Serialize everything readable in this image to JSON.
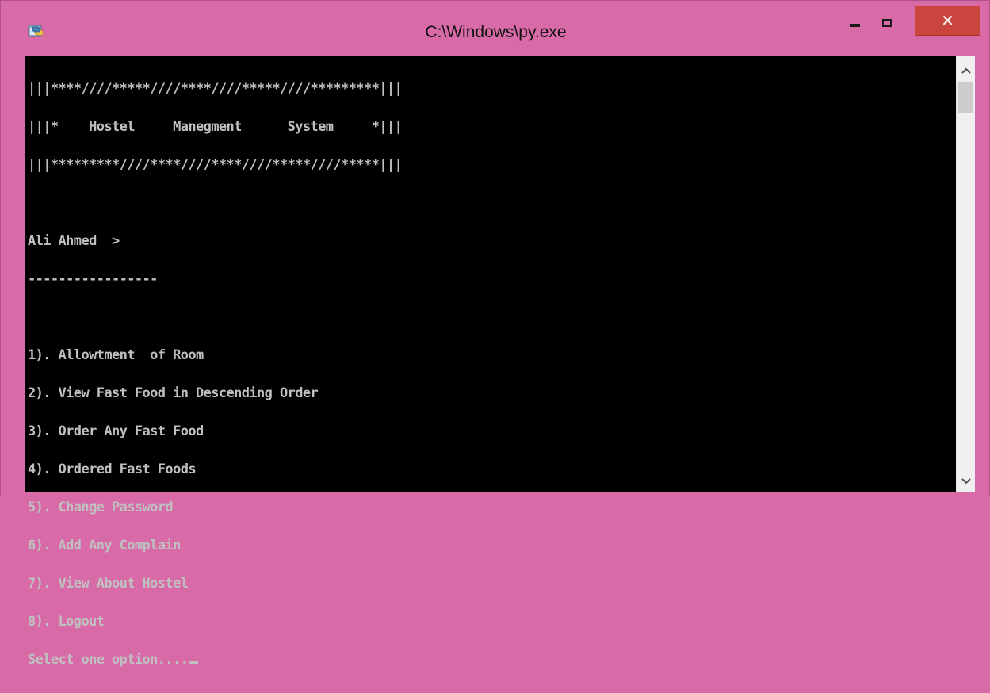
{
  "window": {
    "title": "C:\\Windows\\py.exe",
    "close_glyph": "✕"
  },
  "console": {
    "lines": [
      "|||****////*****////****////*****////*********|||",
      "|||*    Hostel     Manegment      System     *|||",
      "|||*********////****////****////*****////*****|||",
      "",
      "Ali Ahmed  >",
      "-----------------",
      "",
      "1). Allowtment  of Room",
      "2). View Fast Food in Descending Order",
      "3). Order Any Fast Food",
      "4). Ordered Fast Foods",
      "5). Change Password",
      "6). Add Any Complain",
      "7). View About Hostel",
      "8). Logout"
    ],
    "prompt": "Select one option...."
  },
  "scrollbar": {
    "up_glyph": "^",
    "down_glyph": "v"
  }
}
